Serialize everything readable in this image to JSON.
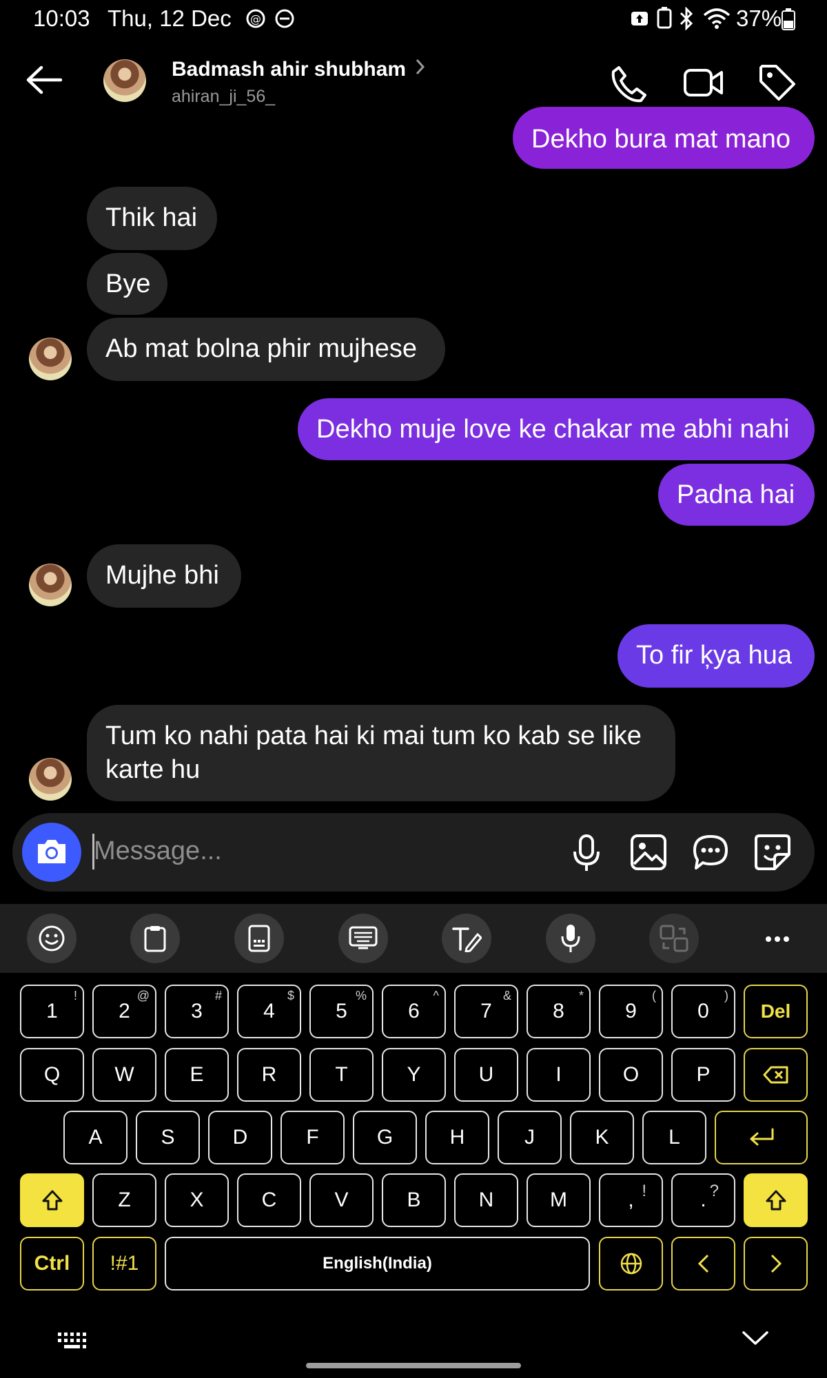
{
  "status": {
    "time": "10:03",
    "date": "Thu, 12 Dec",
    "battery": "37%"
  },
  "header": {
    "name": "Badmash ahir shubham",
    "username": "ahiran_ji_56_"
  },
  "messages": [
    {
      "text": "Dekho bura mat mano",
      "from": "me"
    },
    {
      "text": "Thik hai",
      "from": "them"
    },
    {
      "text": "Bye",
      "from": "them"
    },
    {
      "text": "Ab mat bolna phir mujhese",
      "from": "them"
    },
    {
      "text": "Dekho muje love ke chakar me abhi nahi",
      "from": "me"
    },
    {
      "text": "Padna hai",
      "from": "me"
    },
    {
      "text": "Mujhe bhi",
      "from": "them"
    },
    {
      "text": "To fir ķya hua",
      "from": "me"
    },
    {
      "text": "Tum ko nahi pata hai ki mai tum ko kab se like",
      "text2": "karte hu",
      "from": "them"
    }
  ],
  "composer": {
    "placeholder": "Message..."
  },
  "keyboard": {
    "row1": [
      {
        "k": "1",
        "s": "!"
      },
      {
        "k": "2",
        "s": "@"
      },
      {
        "k": "3",
        "s": "#"
      },
      {
        "k": "4",
        "s": "$"
      },
      {
        "k": "5",
        "s": "%"
      },
      {
        "k": "6",
        "s": "^"
      },
      {
        "k": "7",
        "s": "&"
      },
      {
        "k": "8",
        "s": "*"
      },
      {
        "k": "9",
        "s": "("
      },
      {
        "k": "0",
        "s": ")"
      }
    ],
    "del": "Del",
    "row2": [
      "Q",
      "W",
      "E",
      "R",
      "T",
      "Y",
      "U",
      "I",
      "O",
      "P"
    ],
    "row3": [
      "A",
      "S",
      "D",
      "F",
      "G",
      "H",
      "J",
      "K",
      "L"
    ],
    "row4": [
      "Z",
      "X",
      "C",
      "V",
      "B",
      "N",
      "M"
    ],
    "comma": {
      "k": ",",
      "s": "!"
    },
    "period": {
      "k": ".",
      "s": "?"
    },
    "ctrl": "Ctrl",
    "sym": "!#1",
    "space": "English(India)",
    "accent": "#f3e23f"
  }
}
